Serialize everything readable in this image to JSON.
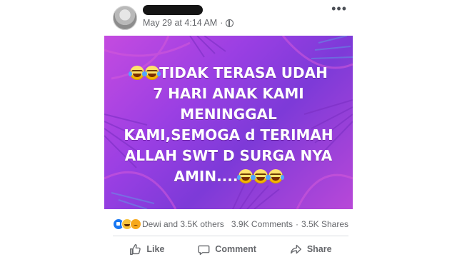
{
  "post": {
    "timestamp": "May 29 at 4:14 AM",
    "separator": "·",
    "more_icon": "more-horizontal-icon",
    "privacy_icon": "globe-icon"
  },
  "image_text": {
    "line1": "TIDAK TERASA UDAH",
    "line2": "7 HARI ANAK KAMI",
    "line3": "MENINGGAL",
    "line4": "KAMI,SEMOGA d TERIMAH",
    "line5": "ALLAH SWT D SURGA NYA",
    "line6": "AMIN...."
  },
  "reactions": {
    "reactors": "Dewi and 3.5K others",
    "comments": "3.9K Comments",
    "dot": "·",
    "shares": "3.5K Shares"
  },
  "actions": {
    "like": "Like",
    "comment": "Comment",
    "share": "Share"
  },
  "colors": {
    "like_blue": "#1877f2",
    "haha_yellow": "#f7c23b",
    "image_purple": "#9a3fe3"
  }
}
